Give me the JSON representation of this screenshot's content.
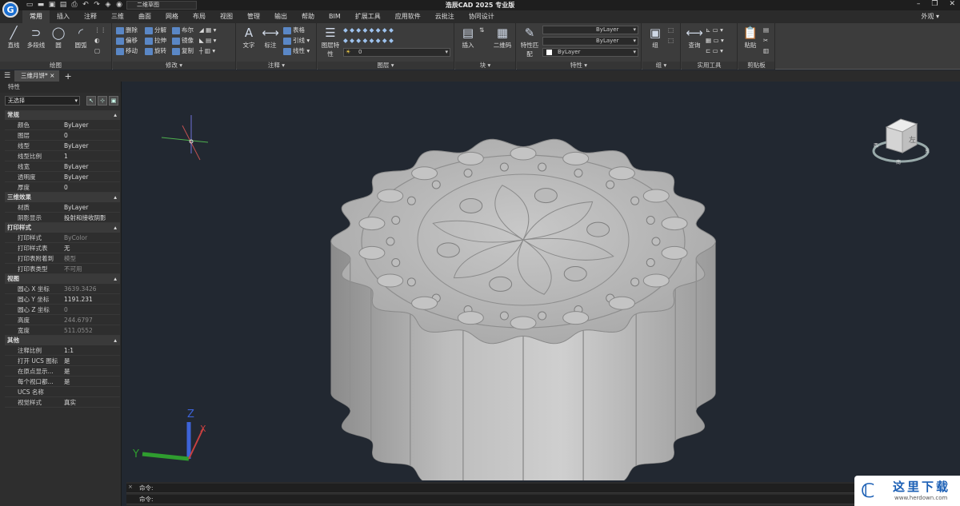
{
  "app": {
    "title": "浩辰CAD 2025 专业版",
    "logo": "G",
    "workspace": "二维草图",
    "view_menu": "外观"
  },
  "ribbon_tabs": [
    "常用",
    "插入",
    "注释",
    "三维",
    "曲面",
    "网格",
    "布局",
    "视图",
    "管理",
    "输出",
    "帮助",
    "BIM",
    "扩展工具",
    "应用软件",
    "云批注",
    "协同设计"
  ],
  "ribbon": {
    "draw": {
      "title": "绘图",
      "line": "直线",
      "polyline": "多段线",
      "circle": "圆",
      "arc": "圆弧"
    },
    "modify": {
      "title": "修改",
      "erase": "删除",
      "explode": "分解",
      "boolean": "布尔",
      "offset": "偏移",
      "stretch": "拉伸",
      "mirror": "镜像",
      "move": "移动",
      "rotate": "旋转",
      "copy": "复制"
    },
    "annotate": {
      "title": "注释",
      "text": "文字",
      "dimension": "标注",
      "table": "表格",
      "leader": "引线",
      "linear": "线性"
    },
    "layer": {
      "title": "图层",
      "props": "图层特性",
      "current": "0"
    },
    "block": {
      "title": "块",
      "insert": "插入",
      "qrcode": "二维码"
    },
    "properties": {
      "title": "特性",
      "match": "特性匹配",
      "color": "ByLayer",
      "linetype": "ByLayer",
      "lineweight": "ByLayer"
    },
    "group": {
      "title": "组",
      "group": "组"
    },
    "utilities": {
      "title": "实用工具",
      "query": "查询"
    },
    "clipboard": {
      "title": "剪贴板",
      "paste": "粘贴"
    }
  },
  "doc_tab": "三维月饼*",
  "props_panel": {
    "header": "特性",
    "selection": "无选择",
    "sections": [
      {
        "title": "常规",
        "rows": [
          [
            "颜色",
            "ByLayer"
          ],
          [
            "图层",
            "0"
          ],
          [
            "线型",
            "ByLayer"
          ],
          [
            "线型比例",
            "1"
          ],
          [
            "线宽",
            "ByLayer"
          ],
          [
            "透明度",
            "ByLayer"
          ],
          [
            "厚度",
            "0"
          ]
        ]
      },
      {
        "title": "三维效果",
        "rows": [
          [
            "材质",
            "ByLayer"
          ],
          [
            "阴影显示",
            "投射和接收阴影"
          ]
        ]
      },
      {
        "title": "打印样式",
        "rows": [
          [
            "打印样式",
            "ByColor"
          ],
          [
            "打印样式表",
            "无"
          ],
          [
            "打印表附着到",
            "模型"
          ],
          [
            "打印表类型",
            "不可用"
          ]
        ]
      },
      {
        "title": "视图",
        "rows": [
          [
            "圆心 X 坐标",
            "3639.3426"
          ],
          [
            "圆心 Y 坐标",
            "1191.231"
          ],
          [
            "圆心 Z 坐标",
            "0"
          ],
          [
            "高度",
            "244.6797"
          ],
          [
            "宽度",
            "511.0552"
          ]
        ]
      },
      {
        "title": "其他",
        "rows": [
          [
            "注释比例",
            "1:1"
          ],
          [
            "打开 UCS 图标",
            "是"
          ],
          [
            "在原点显示...",
            "是"
          ],
          [
            "每个视口都...",
            "是"
          ],
          [
            "UCS 名称",
            ""
          ],
          [
            "视觉样式",
            "真实"
          ]
        ]
      }
    ]
  },
  "viewport": {
    "viewcube_face": "左",
    "axis_x": "X",
    "axis_y": "Y",
    "axis_z": "Z"
  },
  "command": {
    "line1": "命令:",
    "line2": "命令:"
  },
  "watermark": {
    "name": "这里下载",
    "url": "www.herdown.com"
  },
  "colors": {
    "viewport_bg": "#222831",
    "accent": "#1b6fd1"
  }
}
